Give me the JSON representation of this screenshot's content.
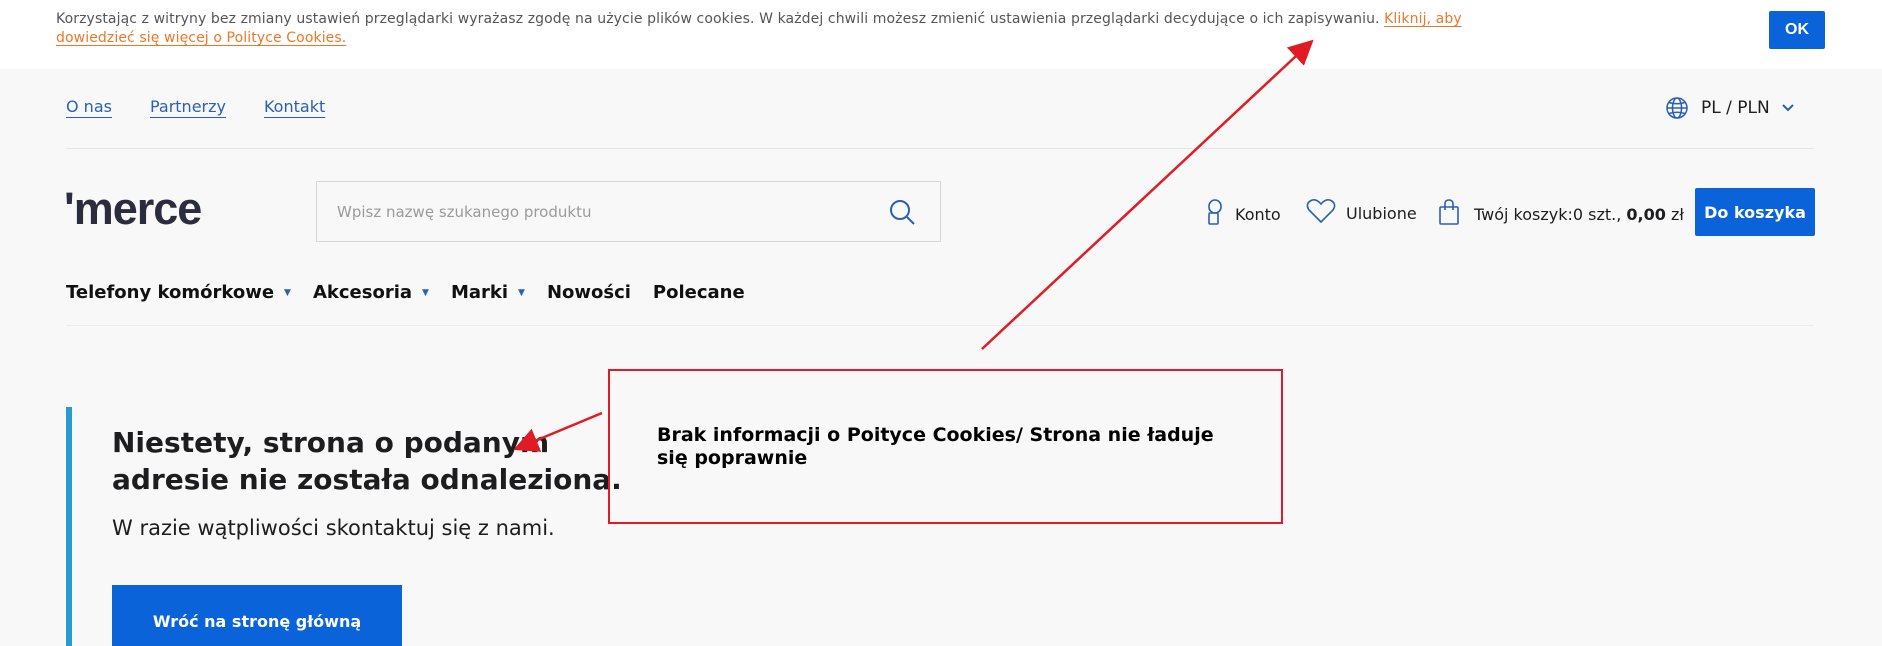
{
  "cookie_bar": {
    "text": "Korzystając z witryny bez zmiany ustawień przeglądarki wyrażasz zgodę na użycie plików cookies. W każdej chwili możesz zmienić ustawienia przeglądarki decydujące o ich zapisywaniu. ",
    "link_text": "Kliknij, aby dowiedzieć się więcej o Polityce Cookies.",
    "ok_label": "OK"
  },
  "top_links": [
    {
      "label": "O nas"
    },
    {
      "label": "Partnerzy"
    },
    {
      "label": "Kontakt"
    }
  ],
  "language": {
    "label": "PL / PLN",
    "icon": "globe-icon"
  },
  "header": {
    "logo": "'merce",
    "search_placeholder": "Wpisz nazwę szukanego produktu",
    "account_label": "Konto",
    "favorites_label": "Ulubione",
    "cart_prefix": "Twój koszyk:",
    "cart_count": "0 szt.,",
    "cart_total": "0,00",
    "cart_currency": "zł",
    "cart_button": "Do koszyka"
  },
  "nav": [
    {
      "label": "Telefony komórkowe",
      "has_dropdown": true
    },
    {
      "label": "Akcesoria",
      "has_dropdown": true
    },
    {
      "label": "Marki",
      "has_dropdown": true
    },
    {
      "label": "Nowości",
      "has_dropdown": false
    },
    {
      "label": "Polecane",
      "has_dropdown": false
    }
  ],
  "error": {
    "title": "Niestety, strona o podanym adresie nie została odnaleziona.",
    "subtitle": "W razie wątpliwości skontaktuj się z nami.",
    "button": "Wróć na stronę główną"
  },
  "annotation": {
    "text": "Brak informacji o Poityce Cookies/ Strona nie ładuje się poprawnie"
  },
  "colors": {
    "primary": "#0b63d9",
    "link": "#2a5fb5",
    "cookie_link": "#e8782a",
    "accent_bar": "#2a9bd1",
    "annotation": "#e01b24"
  }
}
